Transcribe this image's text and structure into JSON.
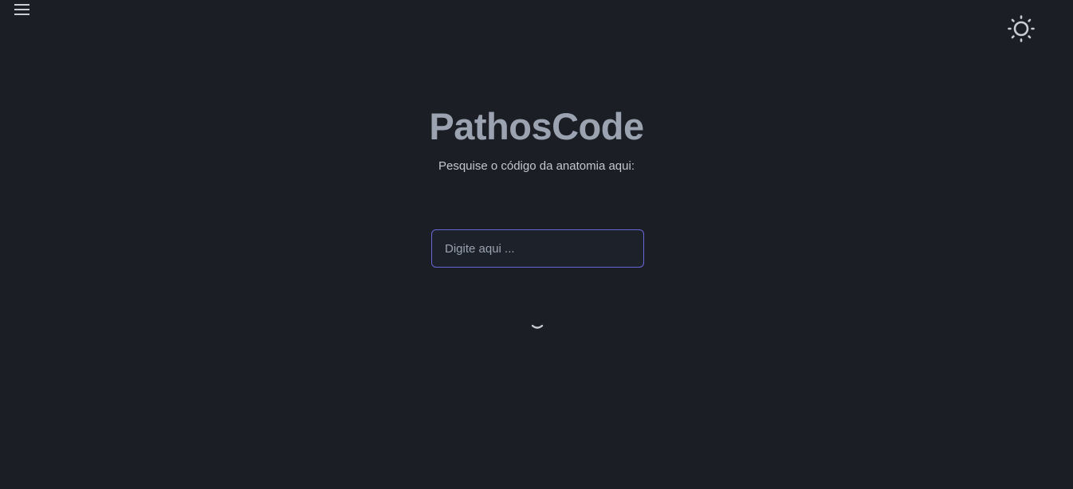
{
  "header": {
    "menu_icon": "hamburger-menu-icon",
    "theme_icon": "sun-icon"
  },
  "main": {
    "title": "PathosCode",
    "subtitle": "Pesquise o código da anatomia aqui:",
    "search": {
      "placeholder": "Digite aqui ...",
      "value": ""
    },
    "loading_icon": "loading-spinner-icon"
  },
  "colors": {
    "background": "#1b1e25",
    "title": "#9ca3b0",
    "text": "#c3c7ce",
    "input_border": "#6a67d8",
    "input_background": "#1c212a"
  }
}
